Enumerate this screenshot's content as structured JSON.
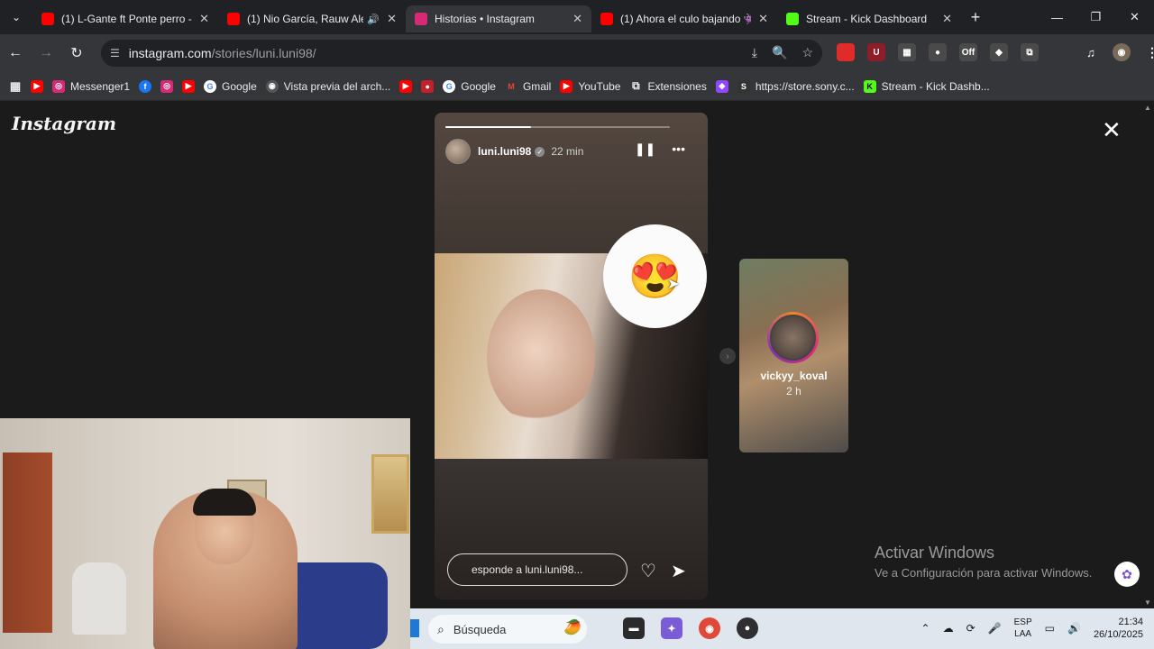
{
  "tabs": [
    {
      "title": "(1) L-Gante ft Ponte perro - I",
      "color": "#ff0000",
      "active": false
    },
    {
      "title": "(1) Nio García, Rauw Ale",
      "color": "#ff0000",
      "active": false,
      "audio": "🔊"
    },
    {
      "title": "Historias • Instagram",
      "color": "#d62976",
      "active": true
    },
    {
      "title": "(1) Ahora el culo bajando 👾",
      "color": "#ff0000",
      "active": false
    },
    {
      "title": "Stream - Kick Dashboard",
      "color": "#53fc18",
      "active": false
    }
  ],
  "tab_close": "✕",
  "tab_menu": "⌄",
  "new_tab": "+",
  "window_controls": {
    "minimize": "—",
    "restore": "❐",
    "close": "✕"
  },
  "nav": {
    "back": "←",
    "forward": "→",
    "reload": "↻"
  },
  "address": {
    "host": "instagram.com",
    "path": "/stories/luni.luni98/"
  },
  "omnibox_icons": {
    "install": "⤓",
    "zoom": "🔍",
    "bookmark": "☆"
  },
  "extensions": [
    {
      "name": "extension-red",
      "label": "",
      "color": "#e02b2b"
    },
    {
      "name": "extension-ublock",
      "label": "U",
      "color": "#8c1d29"
    },
    {
      "name": "extension-gray-1",
      "label": "▦",
      "color": "#4a4a4a"
    },
    {
      "name": "extension-gray-2",
      "label": "●",
      "color": "#4a4a4a"
    },
    {
      "name": "extension-off",
      "label": "Off",
      "color": "#4a4a4a"
    },
    {
      "name": "extension-gray-3",
      "label": "◆",
      "color": "#4a4a4a"
    },
    {
      "name": "extension-puzzle",
      "label": "⧉",
      "color": "#4a4a4a"
    }
  ],
  "toolbar_right": {
    "media": "♫",
    "profile": "◉",
    "menu": "⋮"
  },
  "bookmarks": [
    {
      "label": "",
      "icon": "▦",
      "color": "transparent"
    },
    {
      "label": "",
      "icon": "▶",
      "color": "#ff0000"
    },
    {
      "label": "Messenger1",
      "icon": "◎",
      "color": "#d62976"
    },
    {
      "label": "",
      "icon": "f",
      "color": "#1877f2"
    },
    {
      "label": "",
      "icon": "◎",
      "color": "#d62976"
    },
    {
      "label": "",
      "icon": "▶",
      "color": "#ff0000"
    },
    {
      "label": "Google",
      "icon": "G",
      "color": "#4285f4"
    },
    {
      "label": "Vista previa del arch...",
      "icon": "◉",
      "color": "#555555"
    },
    {
      "label": "",
      "icon": "▶",
      "color": "#ff0000"
    },
    {
      "label": "",
      "icon": "●",
      "color": "#c4202a"
    },
    {
      "label": "Google",
      "icon": "G",
      "color": "#4285f4"
    },
    {
      "label": "Gmail",
      "icon": "M",
      "color": "#ea4335"
    },
    {
      "label": "YouTube",
      "icon": "▶",
      "color": "#ff0000"
    },
    {
      "label": "Extensiones",
      "icon": "⧉",
      "color": "#555555"
    },
    {
      "label": "",
      "icon": "◆",
      "color": "#9146ff"
    },
    {
      "label": "https://store.sony.c...",
      "icon": "S",
      "color": "#333333"
    },
    {
      "label": "Stream - Kick Dashb...",
      "icon": "K",
      "color": "#53fc18"
    }
  ],
  "instagram": {
    "logo": "Instagram",
    "close": "✕",
    "story": {
      "progress": 0.38,
      "username": "luni.luni98",
      "verified": "✓",
      "time": "22 min",
      "pause": "❚❚",
      "more": "•••",
      "emoji": "😍",
      "reply_placeholder": "esponde a luni.luni98...",
      "heart": "♡",
      "send": "➤"
    },
    "next_story": {
      "username": "vickyy_koval",
      "time": "2 h",
      "arrow": "›"
    }
  },
  "activate_windows": {
    "title": "Activar Windows",
    "subtitle": "Ve a Configuración para activar Windows."
  },
  "taskbar": {
    "search_placeholder": "Búsqueda",
    "search_icon": "⌕",
    "search_deco": "🥭",
    "apps": [
      {
        "name": "taskbar-app-explorer",
        "label": "▬",
        "color": "#2b2b2b"
      },
      {
        "name": "taskbar-app-copilot",
        "label": "✦",
        "color": "#7b5cd6"
      },
      {
        "name": "taskbar-app-chrome",
        "label": "◉",
        "color": "#e0483a"
      },
      {
        "name": "taskbar-app-obs",
        "label": "●",
        "color": "#302e31"
      }
    ],
    "tray": {
      "chevron": "⌃",
      "cloud": "☁",
      "sync": "⟳",
      "mic": "🎤",
      "lang_top": "ESP",
      "lang_bottom": "LAA",
      "display": "▭",
      "volume": "🔊",
      "time": "21:34",
      "date": "26/10/2025"
    }
  }
}
